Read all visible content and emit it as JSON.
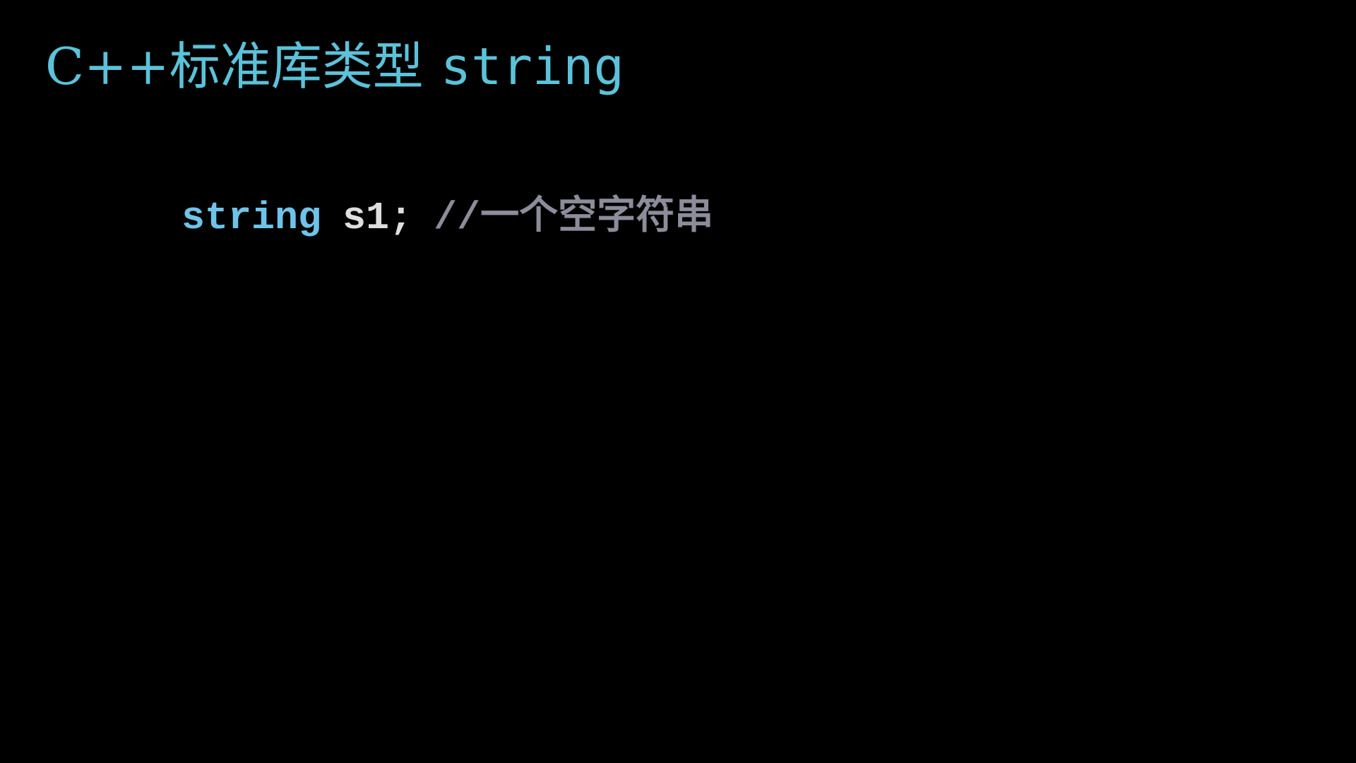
{
  "slide": {
    "title": {
      "prefix": "C++标准库类型",
      "code": "string"
    },
    "code_line": {
      "keyword": "string",
      "statement": "s1;",
      "comment": "//一个空字符串"
    }
  },
  "colors": {
    "background": "#000000",
    "title": "#5bc2d9",
    "keyword": "#6fc3e8",
    "identifier": "#dedede",
    "comment": "#8c8c9a"
  }
}
